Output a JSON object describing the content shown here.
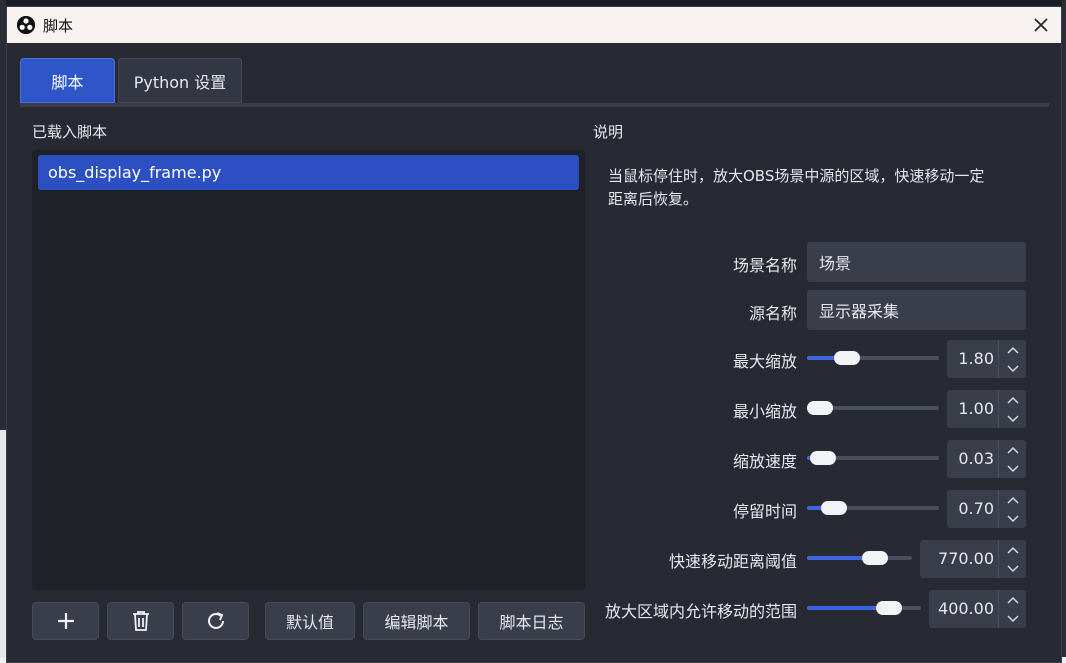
{
  "window": {
    "title": "脚本",
    "close": "✕"
  },
  "tabs": [
    {
      "label": "脚本",
      "active": true
    },
    {
      "label": "Python 设置",
      "active": false
    }
  ],
  "loaded_scripts": {
    "label": "已载入脚本",
    "items": [
      "obs_display_frame.py"
    ]
  },
  "buttons": {
    "add": "+",
    "delete": "trash-icon",
    "reload": "refresh-icon",
    "defaults": "默认值",
    "edit": "编辑脚本",
    "log": "脚本日志"
  },
  "description": {
    "label": "说明",
    "text_line1": "当鼠标停住时，放大OBS场景中源的区域，快速移动一定",
    "text_line2": "距离后恢复。"
  },
  "properties": {
    "scene_name": {
      "label": "场景名称",
      "value": "场景"
    },
    "source_name": {
      "label": "源名称",
      "value": "显示器采集"
    },
    "max_zoom": {
      "label": "最大缩放",
      "value": "1.80",
      "fraction": 0.25
    },
    "min_zoom": {
      "label": "最小缩放",
      "value": "1.00",
      "fraction": 0.0
    },
    "zoom_speed": {
      "label": "缩放速度",
      "value": "0.03",
      "fraction": 0.03
    },
    "dwell_time": {
      "label": "停留时间",
      "value": "0.70",
      "fraction": 0.13
    },
    "move_threshold": {
      "label": "快速移动距离阈值",
      "value": "770.00",
      "fraction": 0.7
    },
    "move_range": {
      "label": "放大区域内允许移动的范围",
      "value": "400.00",
      "fraction": 0.78
    }
  },
  "colors": {
    "accent": "#2e56c9",
    "background": "#272a33",
    "field": "#3a3e4b"
  }
}
